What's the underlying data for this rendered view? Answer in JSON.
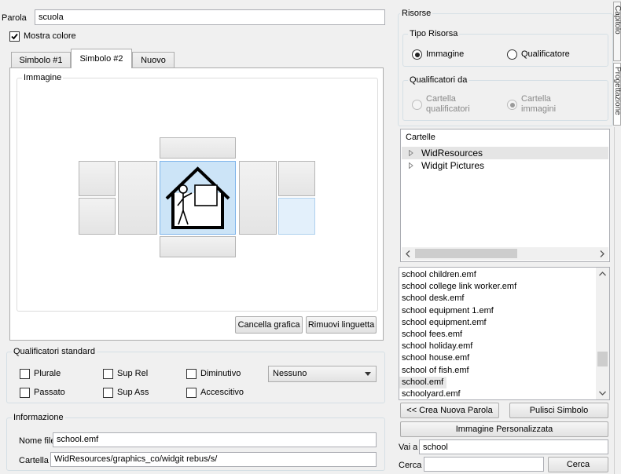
{
  "parola": {
    "label": "Parola",
    "value": "scuola"
  },
  "mostra_colore": {
    "label": "Mostra colore",
    "checked": true
  },
  "tabs": [
    {
      "label": "Simbolo #1",
      "active": false
    },
    {
      "label": "Simbolo #2",
      "active": true
    },
    {
      "label": "Nuovo",
      "active": false
    }
  ],
  "immagine": {
    "title": "Immagine"
  },
  "image_buttons": {
    "cancella": "Cancella grafica",
    "rimuovi": "Rimuovi linguetta"
  },
  "qualificatori_standard": {
    "title": "Qualificatori standard",
    "checks": [
      {
        "label": "Plurale",
        "checked": false
      },
      {
        "label": "Sup Rel",
        "checked": false
      },
      {
        "label": "Diminutivo",
        "checked": false
      },
      {
        "label": "Passato",
        "checked": false
      },
      {
        "label": "Sup Ass",
        "checked": false
      },
      {
        "label": "Accescitivo",
        "checked": false
      }
    ],
    "select_value": "Nessuno"
  },
  "informazione": {
    "title": "Informazione",
    "nome_file_label": "Nome file",
    "nome_file_value": "school.emf",
    "cartella_label": "Cartella",
    "cartella_value": "WidResources/graphics_co/widgit rebus/s/"
  },
  "risorse": {
    "title": "Risorse",
    "tipo_risorsa": {
      "title": "Tipo Risorsa",
      "options": [
        {
          "label": "Immagine",
          "selected": true
        },
        {
          "label": "Qualificatore",
          "selected": false
        }
      ]
    },
    "qualificatori_da": {
      "title": "Qualificatori da",
      "options": [
        {
          "line1": "Cartella",
          "line2": "qualificatori",
          "selected": false
        },
        {
          "line1": "Cartella",
          "line2": "immagini",
          "selected": true
        }
      ]
    },
    "cartelle": {
      "header": "Cartelle",
      "items": [
        "WidResources",
        "Widgit Pictures"
      ]
    },
    "files": [
      "school children.emf",
      "school college link worker.emf",
      "school desk.emf",
      "school equipment 1.emf",
      "school equipment.emf",
      "school fees.emf",
      "school holiday.emf",
      "school house.emf",
      "school of fish.emf",
      "school.emf",
      "schoolyard.emf"
    ],
    "selected_file": "school.emf",
    "buttons": {
      "crea": "<< Crea Nuova Parola",
      "pulisci": "Pulisci Simbolo",
      "personalizzata": "Immagine Personalizzata",
      "cerca": "Cerca"
    },
    "vai_a": {
      "label": "Vai a",
      "value": "school"
    },
    "cerca": {
      "label": "Cerca",
      "value": ""
    }
  },
  "side_tabs": [
    "Capitolo",
    "Progettazione"
  ],
  "colors": {
    "selection": "#cce4f7",
    "selection_border": "#7eb4ea",
    "group_border": "#d5dfe5"
  },
  "icons": [
    "checkbox-checked-icon",
    "tree-expand-icon",
    "scroll-left-icon",
    "scroll-right-icon",
    "scroll-up-icon",
    "scroll-down-icon",
    "dropdown-arrow-icon",
    "school-symbol-icon"
  ]
}
